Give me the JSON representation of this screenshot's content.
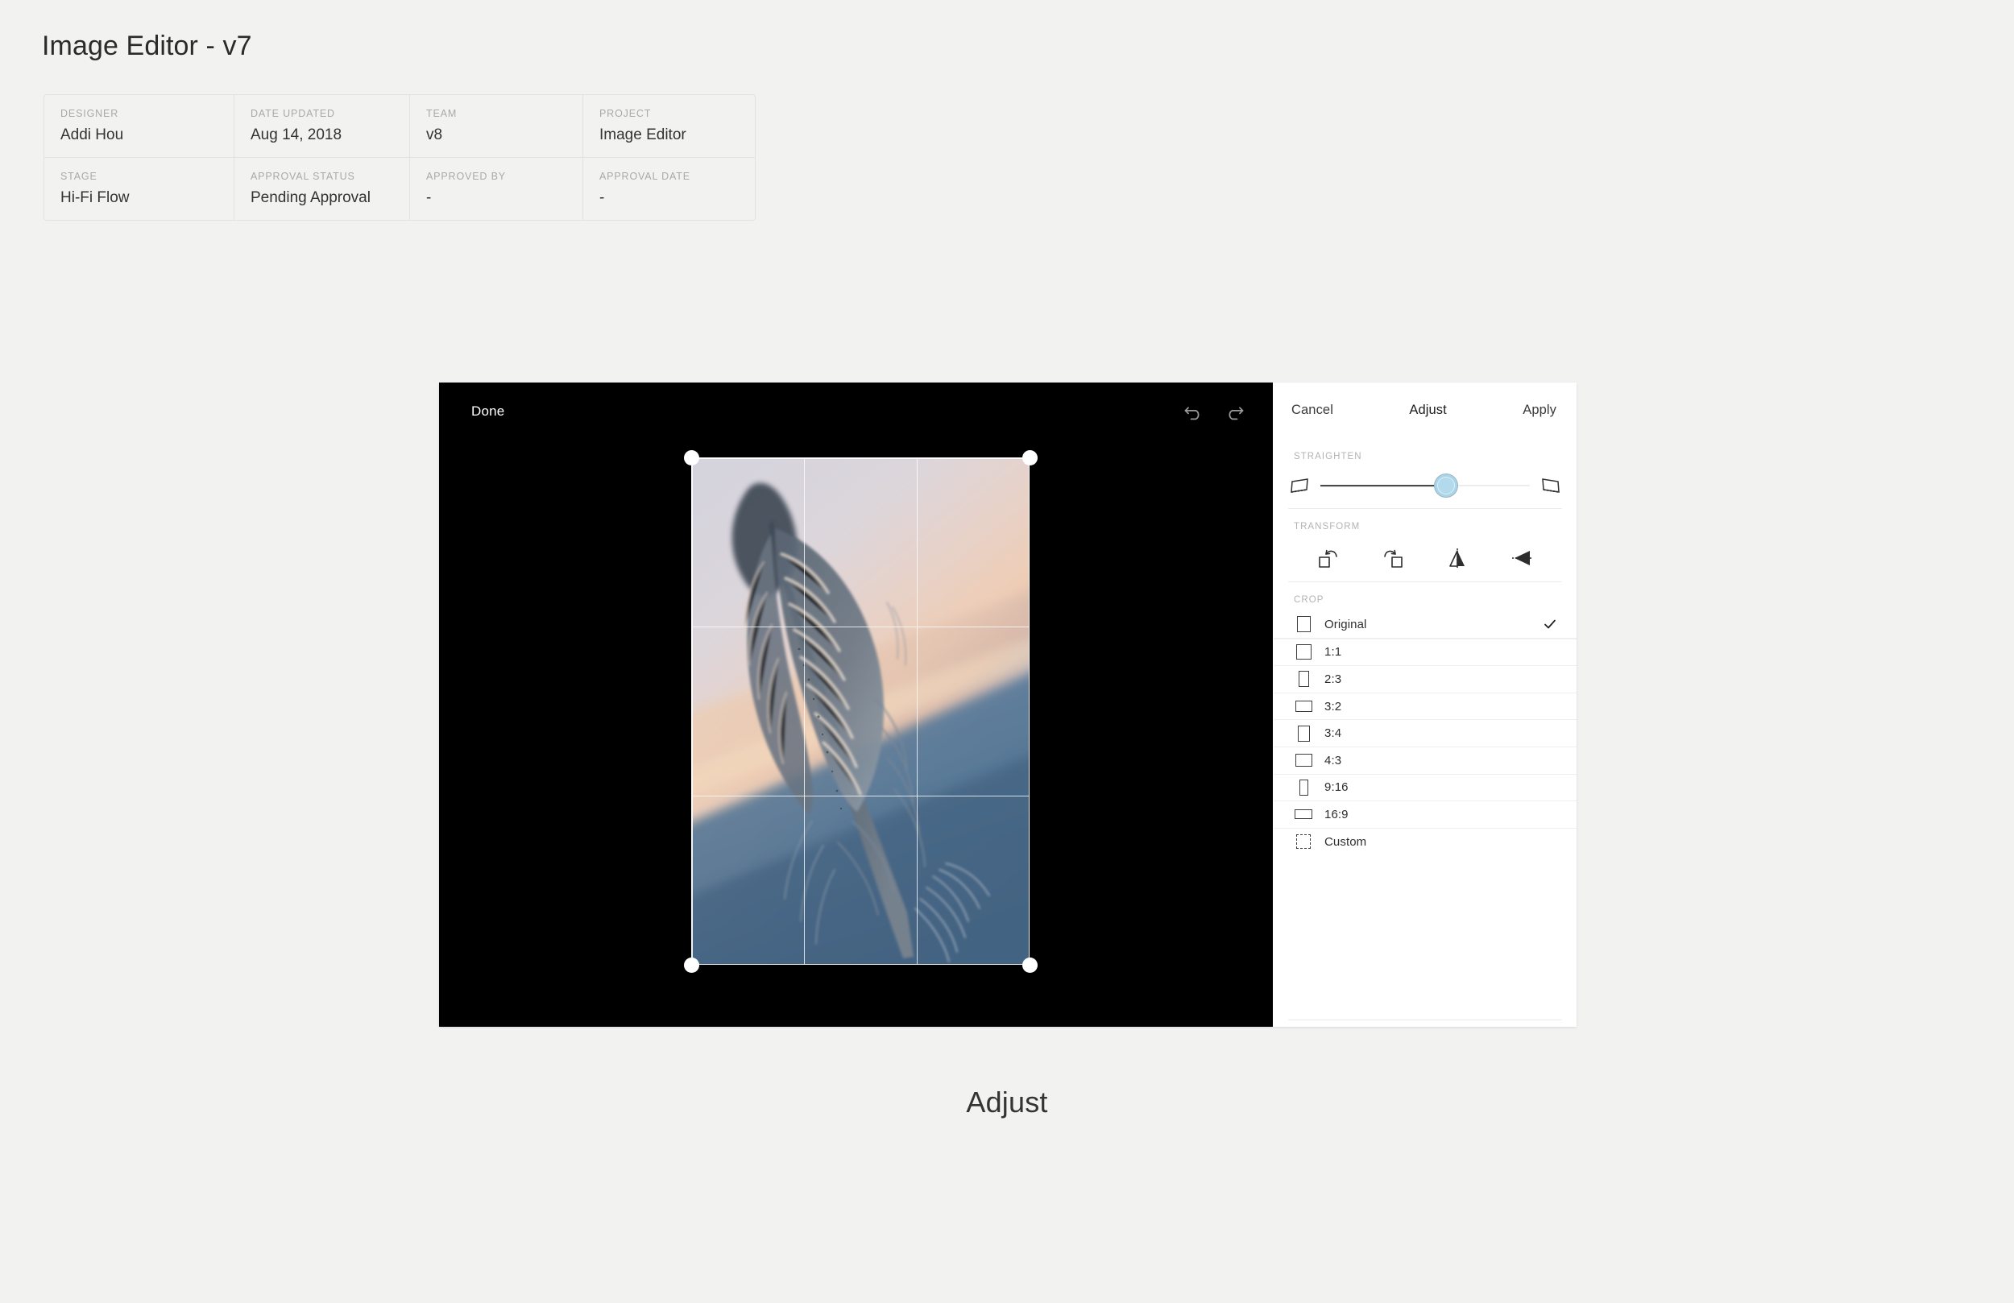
{
  "page": {
    "title": "Image Editor - v7",
    "caption": "Adjust",
    "background_color": "#f2f2f1"
  },
  "meta_table": {
    "rows": [
      [
        {
          "label": "DESIGNER",
          "value": "Addi Hou"
        },
        {
          "label": "DATE UPDATED",
          "value": "Aug 14, 2018"
        },
        {
          "label": "TEAM",
          "value": "v8"
        },
        {
          "label": "PROJECT",
          "value": "Image Editor"
        }
      ],
      [
        {
          "label": "STAGE",
          "value": "Hi-Fi Flow"
        },
        {
          "label": "APPROVAL STATUS",
          "value": "Pending Approval"
        },
        {
          "label": "APPROVED BY",
          "value": "-"
        },
        {
          "label": "APPROVAL DATE",
          "value": "-"
        }
      ]
    ]
  },
  "editor": {
    "canvas": {
      "background_color": "#000000",
      "done_label": "Done",
      "undo_icon": "undo-icon",
      "redo_icon": "redo-icon",
      "crop_overlay": {
        "grid": "rule-of-thirds",
        "handles": [
          "top-left",
          "top-right",
          "bottom-left",
          "bottom-right"
        ],
        "handle_color": "#ffffff"
      },
      "photo_subject": "feather at sunset"
    },
    "panel": {
      "header": {
        "cancel_label": "Cancel",
        "title_label": "Adjust",
        "apply_label": "Apply"
      },
      "straighten": {
        "section_label": "STRAIGHTEN",
        "left_icon": "skew-left-icon",
        "right_icon": "skew-right-icon",
        "knob_color": "#a9d5ea",
        "value_percent": 60
      },
      "transform": {
        "section_label": "TRANSFORM",
        "tools": [
          {
            "name": "rotate-left-icon"
          },
          {
            "name": "rotate-right-icon"
          },
          {
            "name": "flip-horizontal-icon"
          },
          {
            "name": "flip-vertical-icon"
          }
        ]
      },
      "crop": {
        "section_label": "CROP",
        "selected": "Original",
        "check_icon": "check-icon",
        "items": [
          {
            "label": "Original",
            "shape": "square",
            "w": 17,
            "h": 20,
            "dashed": false,
            "selected": true
          },
          {
            "label": "1:1",
            "shape": "square",
            "w": 19,
            "h": 19,
            "dashed": false,
            "selected": false
          },
          {
            "label": "2:3",
            "shape": "portrait",
            "w": 13,
            "h": 20,
            "dashed": false,
            "selected": false
          },
          {
            "label": "3:2",
            "shape": "landscape",
            "w": 21,
            "h": 14,
            "dashed": false,
            "selected": false
          },
          {
            "label": "3:4",
            "shape": "portrait",
            "w": 15,
            "h": 20,
            "dashed": false,
            "selected": false
          },
          {
            "label": "4:3",
            "shape": "landscape",
            "w": 21,
            "h": 16,
            "dashed": false,
            "selected": false
          },
          {
            "label": "9:16",
            "shape": "portrait",
            "w": 11,
            "h": 20,
            "dashed": false,
            "selected": false
          },
          {
            "label": "16:9",
            "shape": "landscape",
            "w": 22,
            "h": 12,
            "dashed": false,
            "selected": false
          },
          {
            "label": "Custom",
            "shape": "square",
            "w": 18,
            "h": 18,
            "dashed": true,
            "selected": false
          }
        ]
      }
    }
  }
}
